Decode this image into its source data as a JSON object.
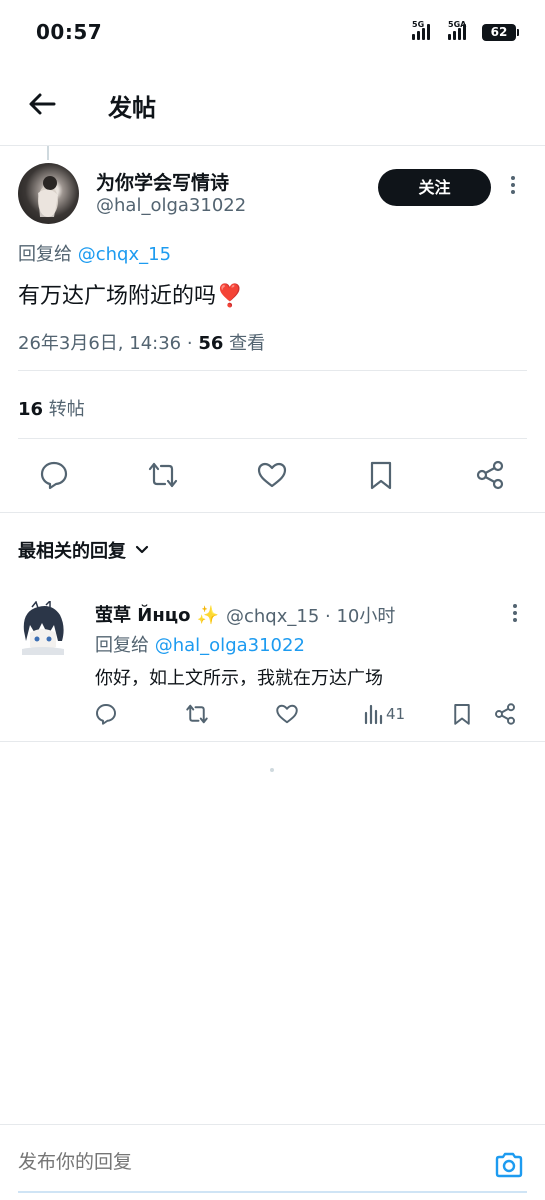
{
  "status_bar": {
    "time": "00:57",
    "signal1_label": "5G",
    "signal2_label": "5GA",
    "battery": "62"
  },
  "header": {
    "title": "发帖",
    "back_icon": "arrow-left-icon"
  },
  "tweet": {
    "author_name": "为你学会写情诗",
    "author_handle": "@hal_olga31022",
    "follow_label": "关注",
    "reply_to_prefix": "回复给",
    "reply_to_handle": "@chqx_15",
    "text": "有万达广场附近的吗",
    "emoji": "❣️",
    "timestamp": "26年3月6日, 14:36 ·",
    "views_count": "56",
    "views_label": "查看",
    "retweet_count": "16",
    "retweet_label": "转帖"
  },
  "actions": [
    "reply-icon",
    "retweet-icon",
    "like-icon",
    "bookmark-icon",
    "share-icon"
  ],
  "sort": {
    "label": "最相关的回复"
  },
  "reply": {
    "author_name": "萤草 Йнцо",
    "sparkle": "✨",
    "author_handle": "@chqx_15 · 10小时",
    "reply_to_prefix": "回复给",
    "reply_to_handle": "@hal_olga31022",
    "text": "你好，如上文所示，我就在万达广场",
    "views": "41"
  },
  "composer": {
    "placeholder": "发布你的回复"
  },
  "colors": {
    "accent": "#1d9bf0",
    "text_primary": "#0f1419",
    "text_secondary": "#536471",
    "divider": "#e6e9ec"
  }
}
